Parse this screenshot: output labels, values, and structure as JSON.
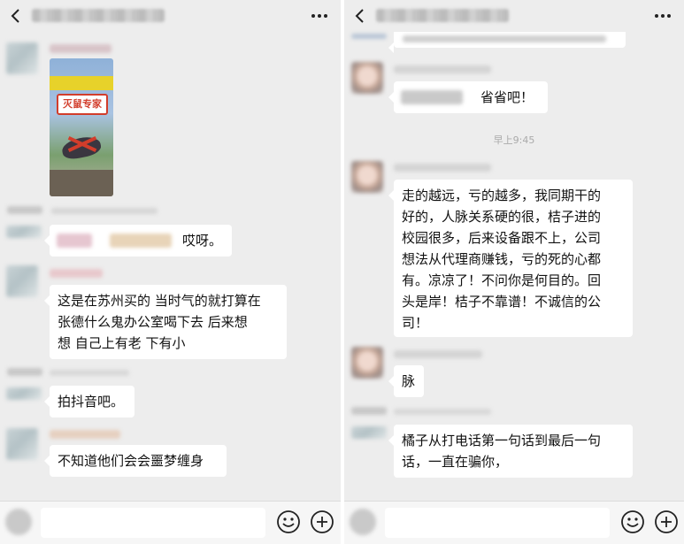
{
  "left": {
    "messages": [
      {
        "text": "哎呀。"
      },
      {
        "lines": [
          "这是在苏州买的 当时气的就打算在",
          "张德什么鬼办公室喝下去 后来想",
          "想 自己上有老 下有小"
        ]
      },
      {
        "text": "拍抖音吧。"
      },
      {
        "text": "不知道他们会会噩梦缠身"
      }
    ],
    "product_label": "灭鼠专家",
    "input_placeholder": ""
  },
  "right": {
    "messages": [
      {
        "text": "省省吧！"
      },
      {
        "lines": [
          "走的越远，亏的越多，我同期干的",
          "好的，人脉关系硬的很，桔子进的",
          "校园很多，后来设备跟不上，公司",
          "想法从代理商赚钱，亏的死的心都",
          "有。凉凉了！不问你是何目的。回",
          "头是岸！桔子不靠谱！不诚信的公",
          "司！"
        ]
      },
      {
        "text": "脉"
      },
      {
        "lines": [
          "橘子从打电话第一句话到最后一句",
          "话，一直在骗你，"
        ]
      }
    ],
    "timestamp": "早上9:45",
    "input_placeholder": ""
  },
  "colors": {
    "chat_bg": "#ededed",
    "bubble_bg": "#ffffff",
    "text": "#111111",
    "timestamp": "#aaaaaa"
  },
  "icons": [
    "back-icon",
    "more-icon",
    "voice-icon",
    "emoji-icon",
    "plus-icon"
  ]
}
